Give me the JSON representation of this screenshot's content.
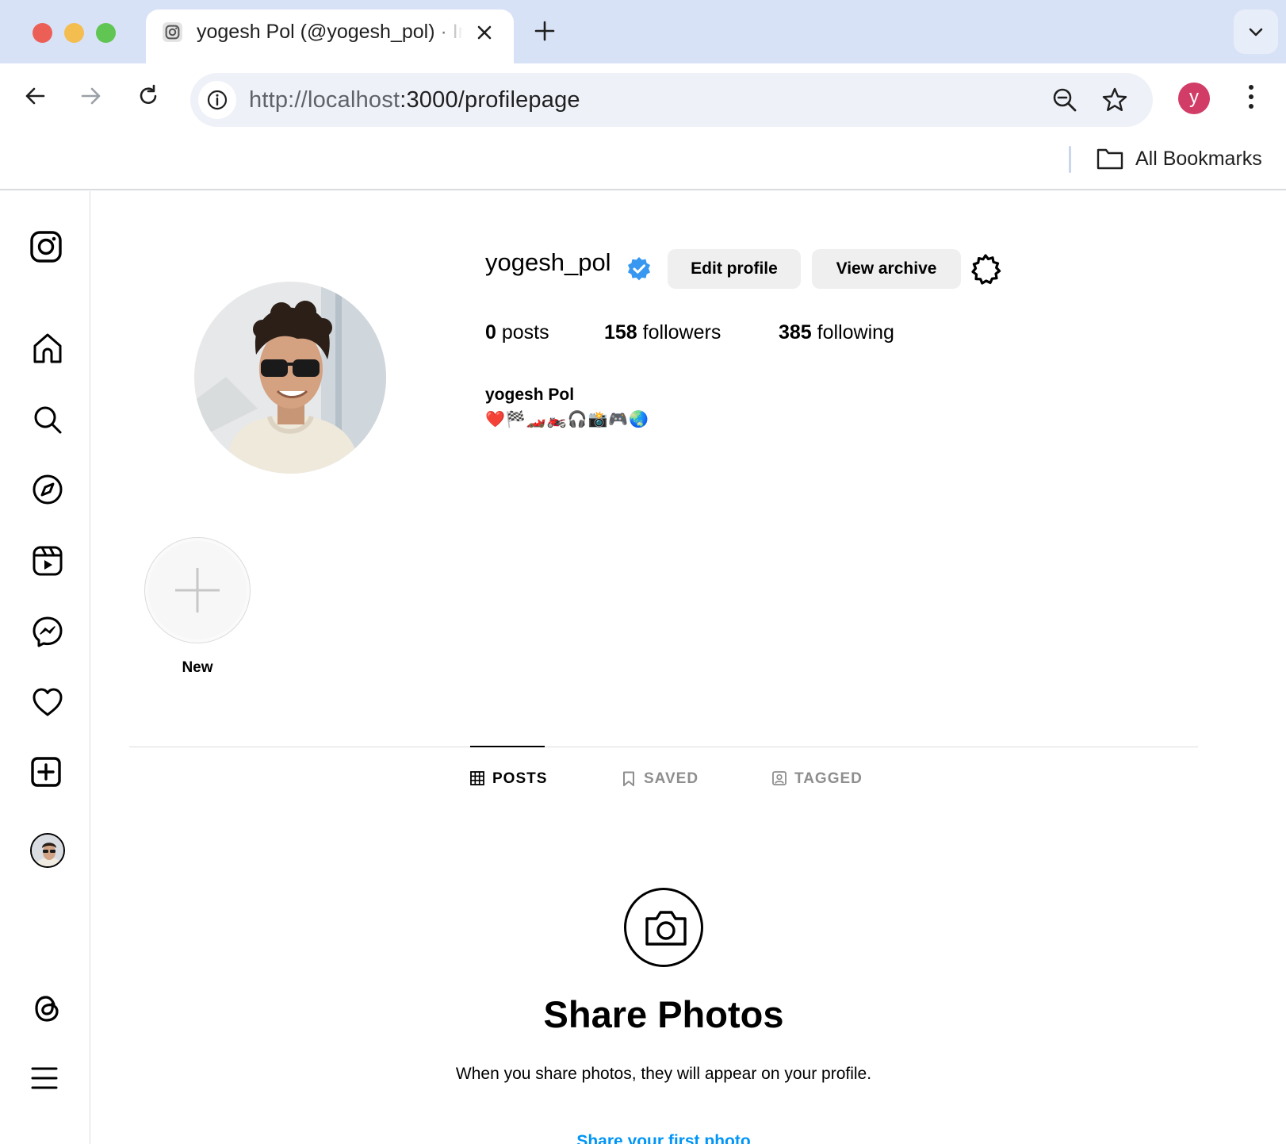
{
  "browser": {
    "tab_title": "yogesh Pol (@yogesh_pol) · Instagram",
    "url_host": "http://localhost",
    "url_rest": ":3000/profilepage",
    "profile_initial": "y",
    "bookmarks_label": "All Bookmarks"
  },
  "profile": {
    "username": "yogesh_pol",
    "edit_label": "Edit profile",
    "archive_label": "View archive",
    "posts_count": "0",
    "posts_label": "posts",
    "followers_count": "158",
    "followers_label": "followers",
    "following_count": "385",
    "following_label": "following",
    "full_name": "yogesh Pol",
    "bio": "❤️🏁🏎️🏍️🎧📸🎮🌏"
  },
  "highlights": {
    "new_label": "New"
  },
  "tabs": [
    {
      "label": "POSTS",
      "active": true
    },
    {
      "label": "SAVED",
      "active": false
    },
    {
      "label": "TAGGED",
      "active": false
    }
  ],
  "empty_state": {
    "title": "Share Photos",
    "description": "When you share photos, they will appear on your profile.",
    "link": "Share your first photo"
  },
  "colors": {
    "tabbar": "#d8e2f6",
    "verified": "#3897f0",
    "link": "#0095f6",
    "avatar_badge": "#d13d67"
  }
}
